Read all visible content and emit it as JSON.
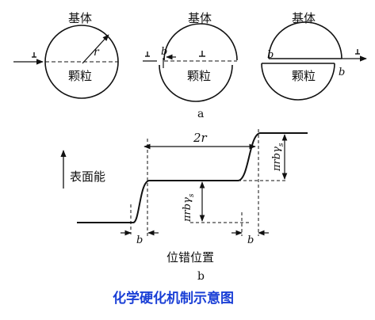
{
  "panel_a": {
    "label": "a",
    "circles": [
      {
        "matrix_label": "基体",
        "particle_label": "颗粒",
        "radius_label": "r"
      },
      {
        "matrix_label": "基体",
        "particle_label": "颗粒",
        "b_label": "b"
      },
      {
        "matrix_label": "基体",
        "particle_label": "颗粒",
        "b_left_label": "b",
        "b_right_label": "b"
      }
    ]
  },
  "panel_b": {
    "label": "b",
    "ylabel": "表面能",
    "xlabel": "位错位置",
    "span_label": "2r",
    "step_label": "πrbγs",
    "step_label_main": "πrbγ",
    "step_label_sub": "s",
    "b_left": "b",
    "b_right": "b"
  },
  "caption": "化学硬化机制示意图",
  "colors": {
    "ink": "#111111",
    "caption": "#1a3fd6"
  }
}
